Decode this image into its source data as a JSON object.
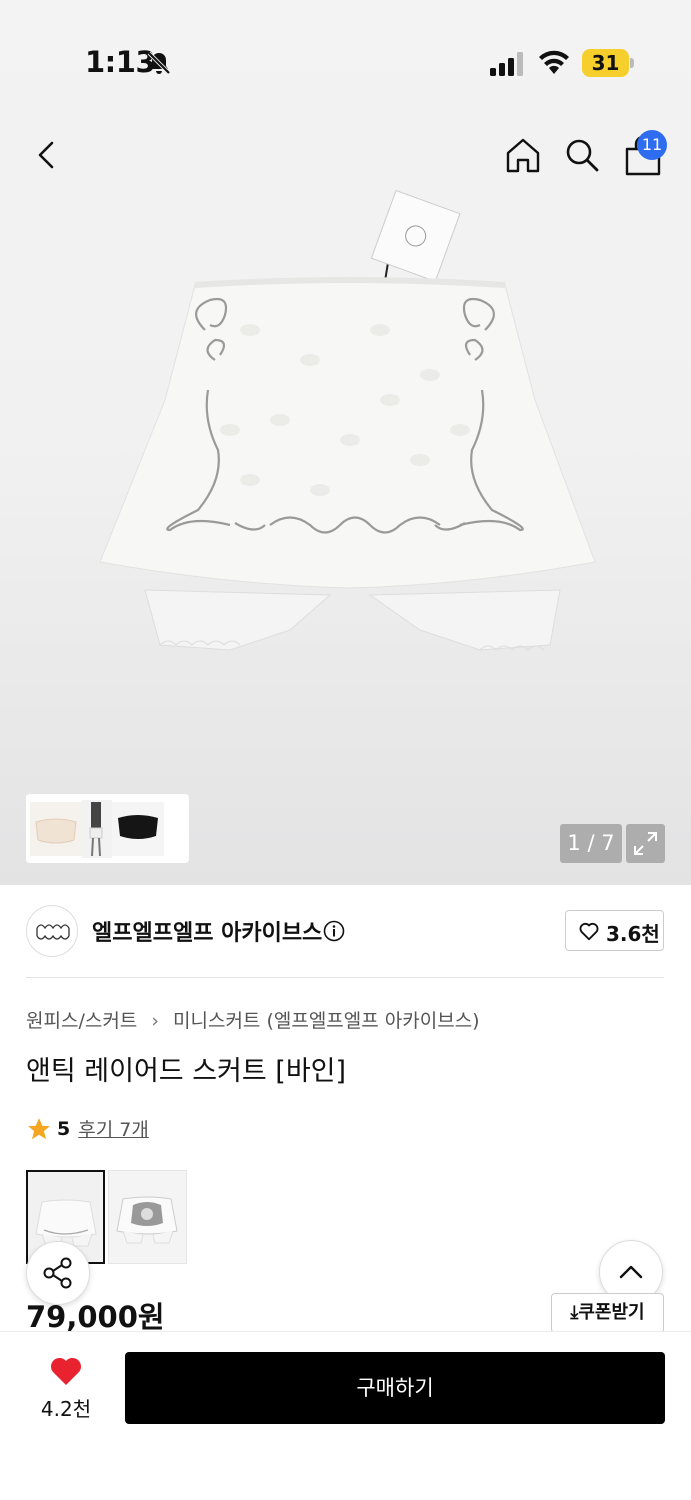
{
  "status_bar": {
    "time": "1:13",
    "battery": "31"
  },
  "nav": {
    "cart_count": "11"
  },
  "gallery": {
    "page_counter": "1 / 7"
  },
  "brand": {
    "name": "엘프엘프엘프 아카이브스",
    "like_count": "3.6천"
  },
  "breadcrumb": {
    "category": "원피스/스커트",
    "subcategory": "미니스커트 (엘프엘프엘프 아카이브스)"
  },
  "product": {
    "title": "앤틱 레이어드 스커트 [바인]",
    "rating": "5",
    "reviews_label": "후기 7개",
    "price": "79,000원",
    "coupon_label": "쿠폰받기"
  },
  "bottom_bar": {
    "wish_count": "4.2천",
    "buy_label": "구매하기"
  },
  "colors": {
    "accent_badge": "#2f6df0",
    "wish_heart": "#e8232f",
    "star": "#f5a623",
    "battery": "#f6cf2c"
  },
  "icons": [
    "bell-slash-icon",
    "signal-icon",
    "wifi-icon",
    "back-icon",
    "home-icon",
    "search-icon",
    "bag-icon",
    "info-icon",
    "heart-icon",
    "star-icon",
    "share-icon",
    "chevron-up-icon",
    "expand-icon",
    "download-icon"
  ]
}
